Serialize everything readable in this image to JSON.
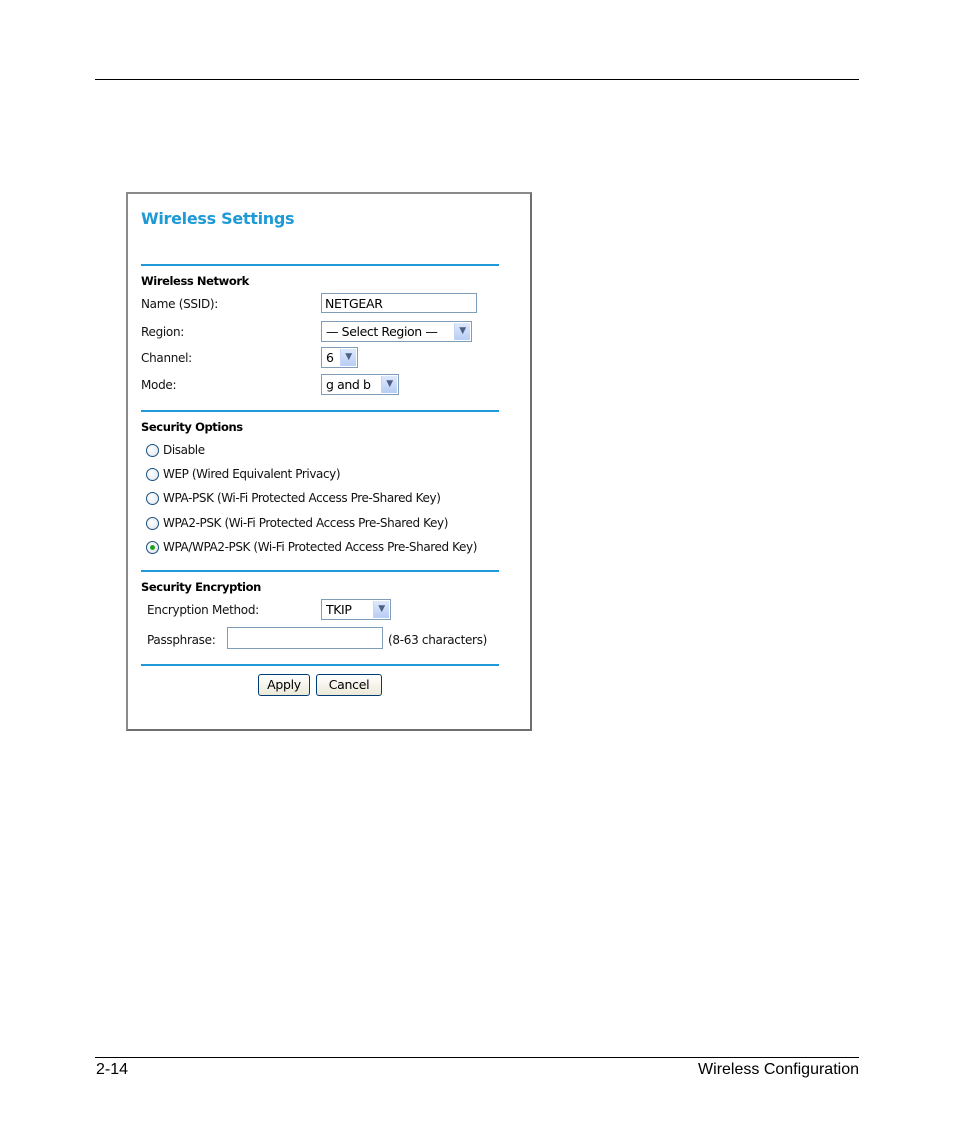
{
  "page": {
    "footer_left": "2-14",
    "footer_right": "Wireless Configuration"
  },
  "screenshot": {
    "title": "Wireless Settings",
    "wireless_network": {
      "heading": "Wireless Network",
      "name_label": "Name (SSID):",
      "name_value": "NETGEAR",
      "region_label": "Region:",
      "region_value": "— Select Region —",
      "channel_label": "Channel:",
      "channel_value": "6",
      "mode_label": "Mode:",
      "mode_value": "g and b"
    },
    "security_options": {
      "heading": "Security Options",
      "options": [
        {
          "label": "Disable",
          "checked": false
        },
        {
          "label": "WEP (Wired Equivalent Privacy)",
          "checked": false
        },
        {
          "label": "WPA-PSK (Wi-Fi Protected Access Pre-Shared Key)",
          "checked": false
        },
        {
          "label": "WPA2-PSK (Wi-Fi Protected Access Pre-Shared Key)",
          "checked": false
        },
        {
          "label": "WPA/WPA2-PSK (Wi-Fi Protected Access Pre-Shared Key)",
          "checked": true
        }
      ]
    },
    "security_encryption": {
      "heading": "Security Encryption",
      "method_label": "Encryption Method:",
      "method_value": "TKIP",
      "passphrase_label": "Passphrase:",
      "passphrase_value": "",
      "passphrase_hint": "(8-63 characters)"
    },
    "buttons": {
      "apply": "Apply",
      "cancel": "Cancel"
    },
    "colors": {
      "accent": "#1e9ad6"
    }
  }
}
